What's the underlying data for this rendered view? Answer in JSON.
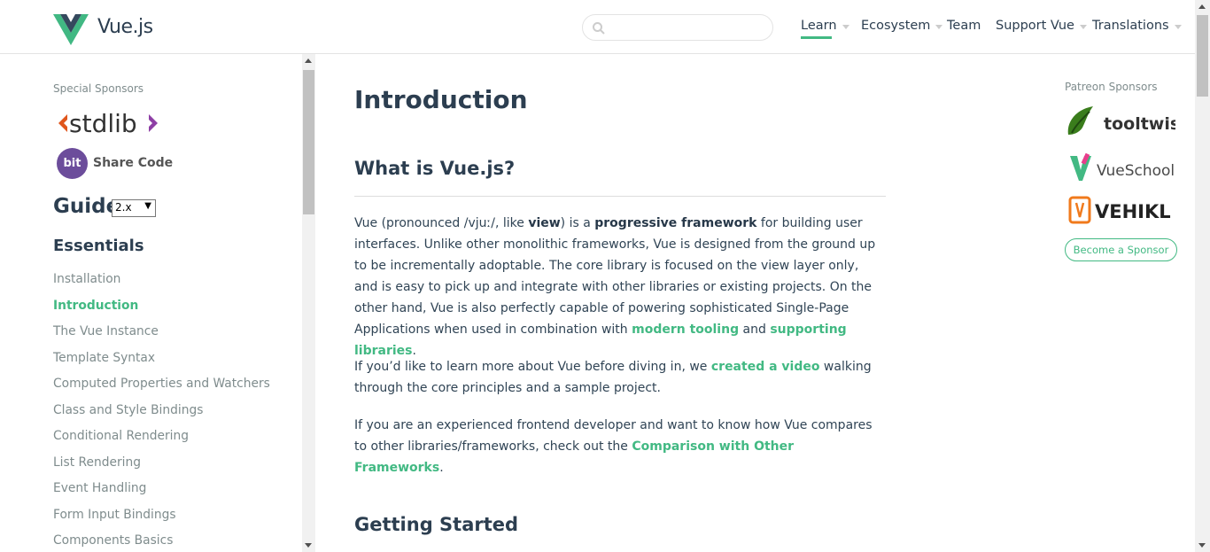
{
  "header": {
    "brand": "Vue.js",
    "search_placeholder": "",
    "nav": [
      {
        "label": "Learn",
        "dropdown": true,
        "active": true
      },
      {
        "label": "Ecosystem",
        "dropdown": true
      },
      {
        "label": "Team",
        "dropdown": false
      },
      {
        "label": "Support Vue",
        "dropdown": true
      },
      {
        "label": "Translations",
        "dropdown": true
      }
    ]
  },
  "sidebar": {
    "special_sponsors_label": "Special Sponsors",
    "stdlib_text": "stdlib",
    "bit_badge": "bit",
    "bit_text": "Share Code",
    "guide_title": "Guide",
    "version": "2.x",
    "section_title": "Essentials",
    "items": [
      {
        "label": "Installation",
        "active": false
      },
      {
        "label": "Introduction",
        "active": true
      },
      {
        "label": "The Vue Instance",
        "active": false
      },
      {
        "label": "Template Syntax",
        "active": false
      },
      {
        "label": "Computed Properties and Watchers",
        "active": false
      },
      {
        "label": "Class and Style Bindings",
        "active": false
      },
      {
        "label": "Conditional Rendering",
        "active": false
      },
      {
        "label": "List Rendering",
        "active": false
      },
      {
        "label": "Event Handling",
        "active": false
      },
      {
        "label": "Form Input Bindings",
        "active": false
      },
      {
        "label": "Components Basics",
        "active": false
      }
    ]
  },
  "content": {
    "title": "Introduction",
    "what_is": "What is Vue.js?",
    "p1": {
      "t1": "Vue (pronounced /vjuː/, like ",
      "b1": "view",
      "t2": ") is a ",
      "b2": "progressive framework",
      "t3": " for building user interfaces. Unlike other monolithic frameworks, Vue is designed from the ground up to be incrementally adoptable. The core library is focused on the view layer only, and is easy to pick up and integrate with other libraries or existing projects. On the other hand, Vue is also perfectly capable of powering sophisticated Single-Page Applications when used in combination with ",
      "link1": "modern tooling",
      "t4": " and ",
      "link2": "supporting libraries",
      "t5": "."
    },
    "p2": {
      "t1": "If you’d like to learn more about Vue before diving in, we ",
      "link": "created a video",
      "t2": " walking through the core principles and a sample project."
    },
    "p3": {
      "t1": "If you are an experienced frontend developer and want to know how Vue compares to other libraries/frameworks, check out the ",
      "link": "Comparison with Other Frameworks",
      "t2": "."
    },
    "getting_started": "Getting Started"
  },
  "right": {
    "patreon_label": "Patreon Sponsors",
    "tooltwist": "tooltwist",
    "vueschool": "VueSchool",
    "vehikl": "VEHIKL",
    "become_sponsor": "Become a Sponsor"
  },
  "colors": {
    "accent": "#42b983",
    "text": "#304455",
    "heading": "#2c3e50",
    "muted": "#7f8c8d"
  }
}
